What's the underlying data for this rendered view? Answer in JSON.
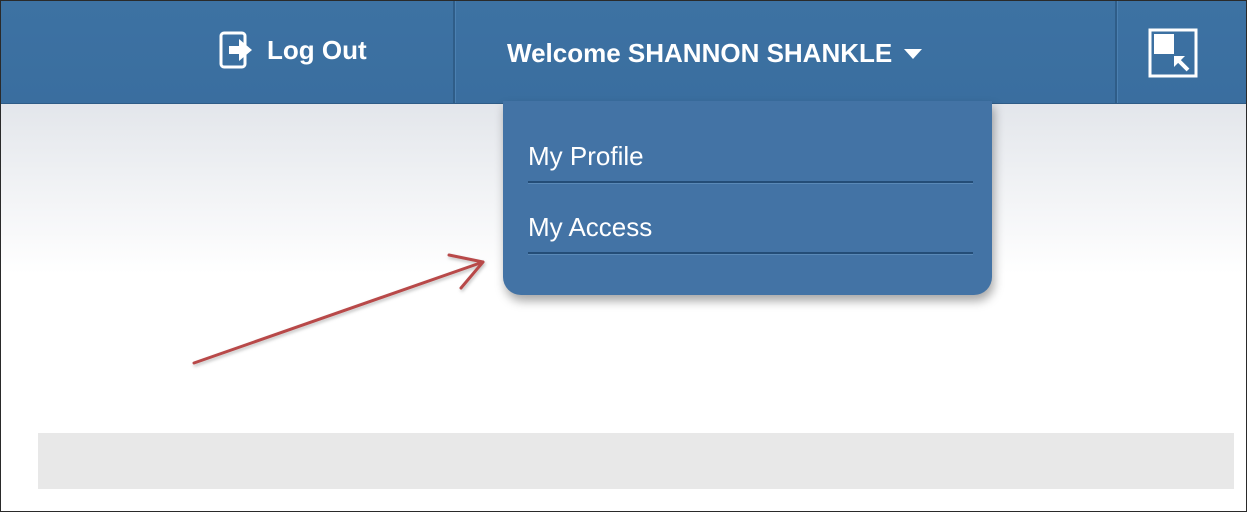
{
  "header": {
    "logout_label": "Log Out",
    "welcome_text": "Welcome SHANNON SHANKLE",
    "icons": {
      "logout": "logout-icon",
      "dropdown": "caret-down-icon",
      "corner": "window-restore-icon"
    }
  },
  "dropdown_menu": {
    "items": [
      {
        "label": "My Profile"
      },
      {
        "label": "My Access"
      }
    ]
  },
  "annotation": {
    "type": "arrow",
    "points_to": "My Access",
    "color": "#b84a4a"
  },
  "colors": {
    "topbar": "#3a6e9f",
    "dropdown": "#4373a5",
    "text": "#ffffff"
  }
}
